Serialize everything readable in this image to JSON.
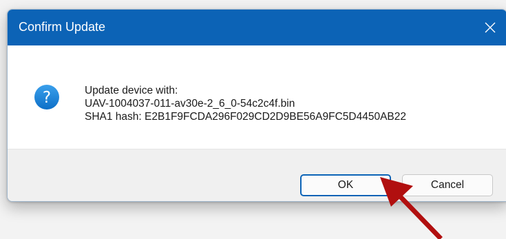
{
  "dialog": {
    "title": "Confirm Update",
    "close_icon": "close-icon",
    "message_icon": "question-icon",
    "message_lines": [
      "Update device with:",
      "UAV-1004037-011-av30e-2_6_0-54c2c4f.bin",
      "SHA1 hash: E2B1F9FCDA296F029CD2D9BE56A9FC5D4450AB22"
    ],
    "buttons": {
      "ok": "OK",
      "cancel": "Cancel"
    }
  },
  "annotation": {
    "icon": "pointer-arrow-icon"
  },
  "colors": {
    "titlebar": "#0c63b6",
    "title_text": "#ffffff",
    "ok_border": "#0b63b6",
    "arrow": "#b10f0f"
  }
}
